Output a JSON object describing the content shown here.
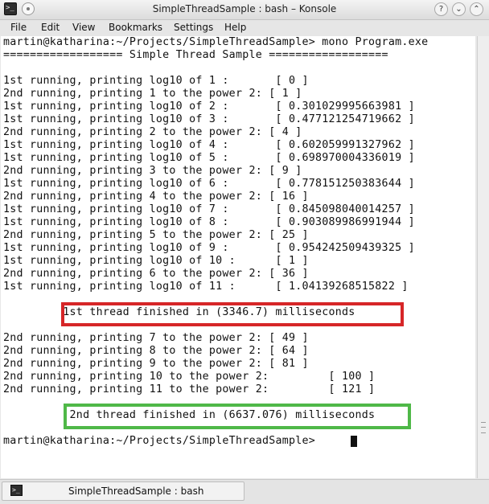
{
  "window": {
    "title": "SimpleThreadSample : bash – Konsole",
    "help_glyph": "?",
    "minimize_glyph": "⌄",
    "maximize_glyph": "⌃",
    "app_glyph": ">_"
  },
  "menu": {
    "items": [
      {
        "label": "File"
      },
      {
        "label": "Edit"
      },
      {
        "label": "View"
      },
      {
        "label": "Bookmarks"
      },
      {
        "label": "Settings"
      },
      {
        "label": "Help"
      }
    ]
  },
  "terminal": {
    "lines": [
      "martin@katharina:~/Projects/SimpleThreadSample> mono Program.exe",
      "================== Simple Thread Sample ==================",
      "",
      "1st running, printing log10 of 1 :       [ 0 ]",
      "2nd running, printing 1 to the power 2: [ 1 ]",
      "1st running, printing log10 of 2 :       [ 0.301029995663981 ]",
      "1st running, printing log10 of 3 :       [ 0.477121254719662 ]",
      "2nd running, printing 2 to the power 2: [ 4 ]",
      "1st running, printing log10 of 4 :       [ 0.602059991327962 ]",
      "1st running, printing log10 of 5 :       [ 0.698970004336019 ]",
      "2nd running, printing 3 to the power 2: [ 9 ]",
      "1st running, printing log10 of 6 :       [ 0.778151250383644 ]",
      "2nd running, printing 4 to the power 2: [ 16 ]",
      "1st running, printing log10 of 7 :       [ 0.845098040014257 ]",
      "1st running, printing log10 of 8 :       [ 0.903089986991944 ]",
      "2nd running, printing 5 to the power 2: [ 25 ]",
      "1st running, printing log10 of 9 :       [ 0.954242509439325 ]",
      "1st running, printing log10 of 10 :      [ 1 ]",
      "2nd running, printing 6 to the power 2: [ 36 ]",
      "1st running, printing log10 of 11 :      [ 1.04139268515822 ]",
      "",
      "         1st thread finished in (3346.7) milliseconds",
      "",
      "2nd running, printing 7 to the power 2: [ 49 ]",
      "2nd running, printing 8 to the power 2: [ 64 ]",
      "2nd running, printing 9 to the power 2: [ 81 ]",
      "2nd running, printing 10 to the power 2:         [ 100 ]",
      "2nd running, printing 11 to the power 2:         [ 121 ]",
      "",
      "          2nd thread finished in (6637.076) milliseconds",
      "",
      "martin@katharina:~/Projects/SimpleThreadSample> "
    ]
  },
  "tabs": [
    {
      "label": "SimpleThreadSample : bash"
    }
  ],
  "colors": {
    "highlight_first": "#d62628",
    "highlight_second": "#4fb848"
  }
}
